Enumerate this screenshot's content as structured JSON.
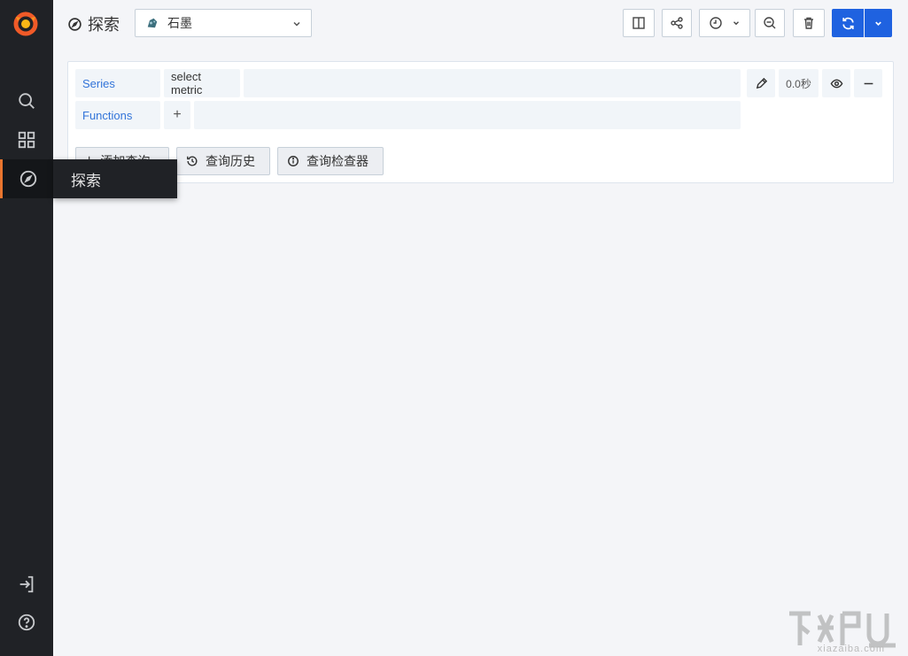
{
  "sidebar": {
    "tooltip": "探索",
    "items": [
      {
        "name": "search",
        "icon": "search-icon"
      },
      {
        "name": "dashboards",
        "icon": "grid-icon"
      },
      {
        "name": "explore",
        "icon": "compass-icon",
        "active": true
      },
      {
        "name": "sign-in",
        "icon": "sign-in-icon"
      },
      {
        "name": "help",
        "icon": "help-icon"
      }
    ]
  },
  "header": {
    "title": "探索",
    "datasource": "石墨"
  },
  "toolbar": {
    "split_icon": "split-icon",
    "share_icon": "share-icon",
    "time_icon": "clock-icon",
    "zoom_icon": "zoom-out-icon",
    "clear_icon": "trash-icon",
    "run_icon": "refresh-icon"
  },
  "query": {
    "series_label": "Series",
    "metric_chip": "select metric",
    "functions_label": "Functions",
    "add_function": "+",
    "timing": "0.0秒"
  },
  "actions": {
    "add_query": "添加查询",
    "query_history": "查询历史",
    "query_inspector": "查询检查器"
  },
  "watermark": "xiazaiba.com",
  "colors": {
    "sidebar_bg": "#202226",
    "accent": "#e9752e",
    "primary": "#1f62e0",
    "label_blue": "#3274d9"
  }
}
